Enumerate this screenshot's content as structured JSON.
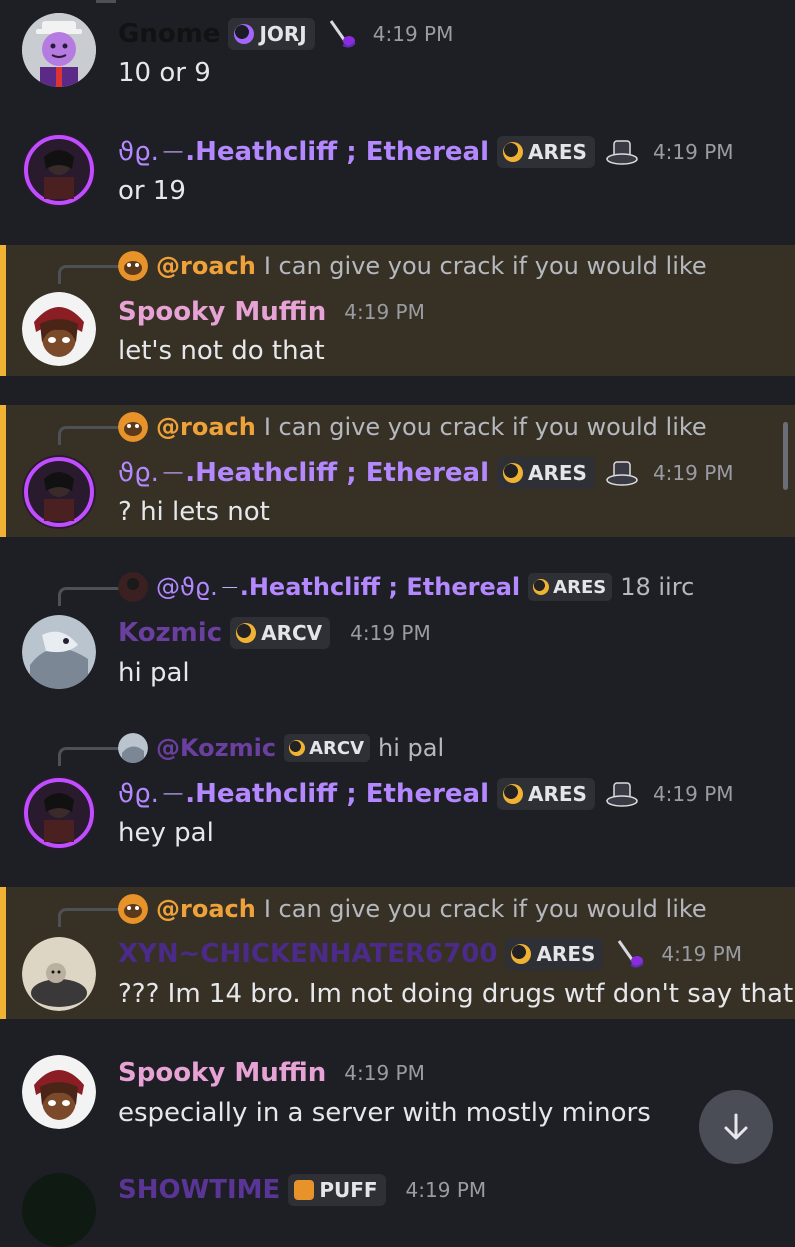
{
  "colors": {
    "highlight_bg": "#373125",
    "highlight_bar": "#f0b232",
    "bg": "#1e1f24"
  },
  "messages": [
    {
      "name": "Gnome",
      "name_color": "#111214",
      "tag": "JORJ",
      "time": "4:19 PM",
      "text": "10 or 9",
      "avatar": "gnome-avatar",
      "decoration": "feather-pen-icon"
    },
    {
      "name_prefix": "ϑϱ.",
      "name": ".Heathcliff ; Ethereal",
      "name_color": "#b488ff",
      "tag": "ARES",
      "time": "4:19 PM",
      "text": "or 19",
      "avatar": "heathcliff-avatar",
      "decoration": "top-hat-icon"
    },
    {
      "reply": {
        "name": "@roach",
        "text": "I can give you crack if you would like"
      },
      "name": "Spooky Muffin",
      "name_color": "#e8a3d6",
      "time": "4:19 PM",
      "text": "let's not do that",
      "avatar": "spooky-avatar"
    },
    {
      "reply": {
        "name": "@roach",
        "text": "I can give you crack if you would like"
      },
      "name_prefix": "ϑϱ.",
      "name": ".Heathcliff ; Ethereal",
      "name_color": "#b488ff",
      "tag": "ARES",
      "time": "4:19 PM",
      "text": "? hi lets not",
      "avatar": "heathcliff-avatar",
      "decoration": "top-hat-icon"
    },
    {
      "reply": {
        "name_prefix": "@ϑϱ.",
        "name": ".Heathcliff ; Ethereal",
        "tag": "ARES",
        "text": "18 iirc"
      },
      "name": "Kozmic",
      "name_color": "#6b3fa0",
      "tag": "ARCV",
      "time": "4:19 PM",
      "text": "hi pal",
      "avatar": "kozmic-avatar"
    },
    {
      "reply": {
        "name": "@Kozmic",
        "tag": "ARCV",
        "text": "hi pal"
      },
      "name_prefix": "ϑϱ.",
      "name": ".Heathcliff ; Ethereal",
      "name_color": "#b488ff",
      "tag": "ARES",
      "time": "4:19 PM",
      "text": "hey pal",
      "avatar": "heathcliff-avatar",
      "decoration": "top-hat-icon"
    },
    {
      "reply": {
        "name": "@roach",
        "text": "I can give you crack if you would like"
      },
      "name": "XYN~CHICKENHATER6700",
      "name_color": "#4b2a8a",
      "tag": "ARES",
      "time": "4:19 PM",
      "text": "??? Im 14 bro. Im not doing drugs wtf don't say that",
      "avatar": "chicken-avatar",
      "decoration": "feather-pen-icon"
    },
    {
      "name": "Spooky Muffin",
      "name_color": "#e8a3d6",
      "time": "4:19 PM",
      "text": "especially in a server with mostly minors",
      "avatar": "spooky-avatar"
    },
    {
      "name": "SHOWTIME",
      "name_color": "#5a3596",
      "tag": "PUFF",
      "time": "4:19 PM",
      "avatar": "showtime-avatar"
    }
  ]
}
